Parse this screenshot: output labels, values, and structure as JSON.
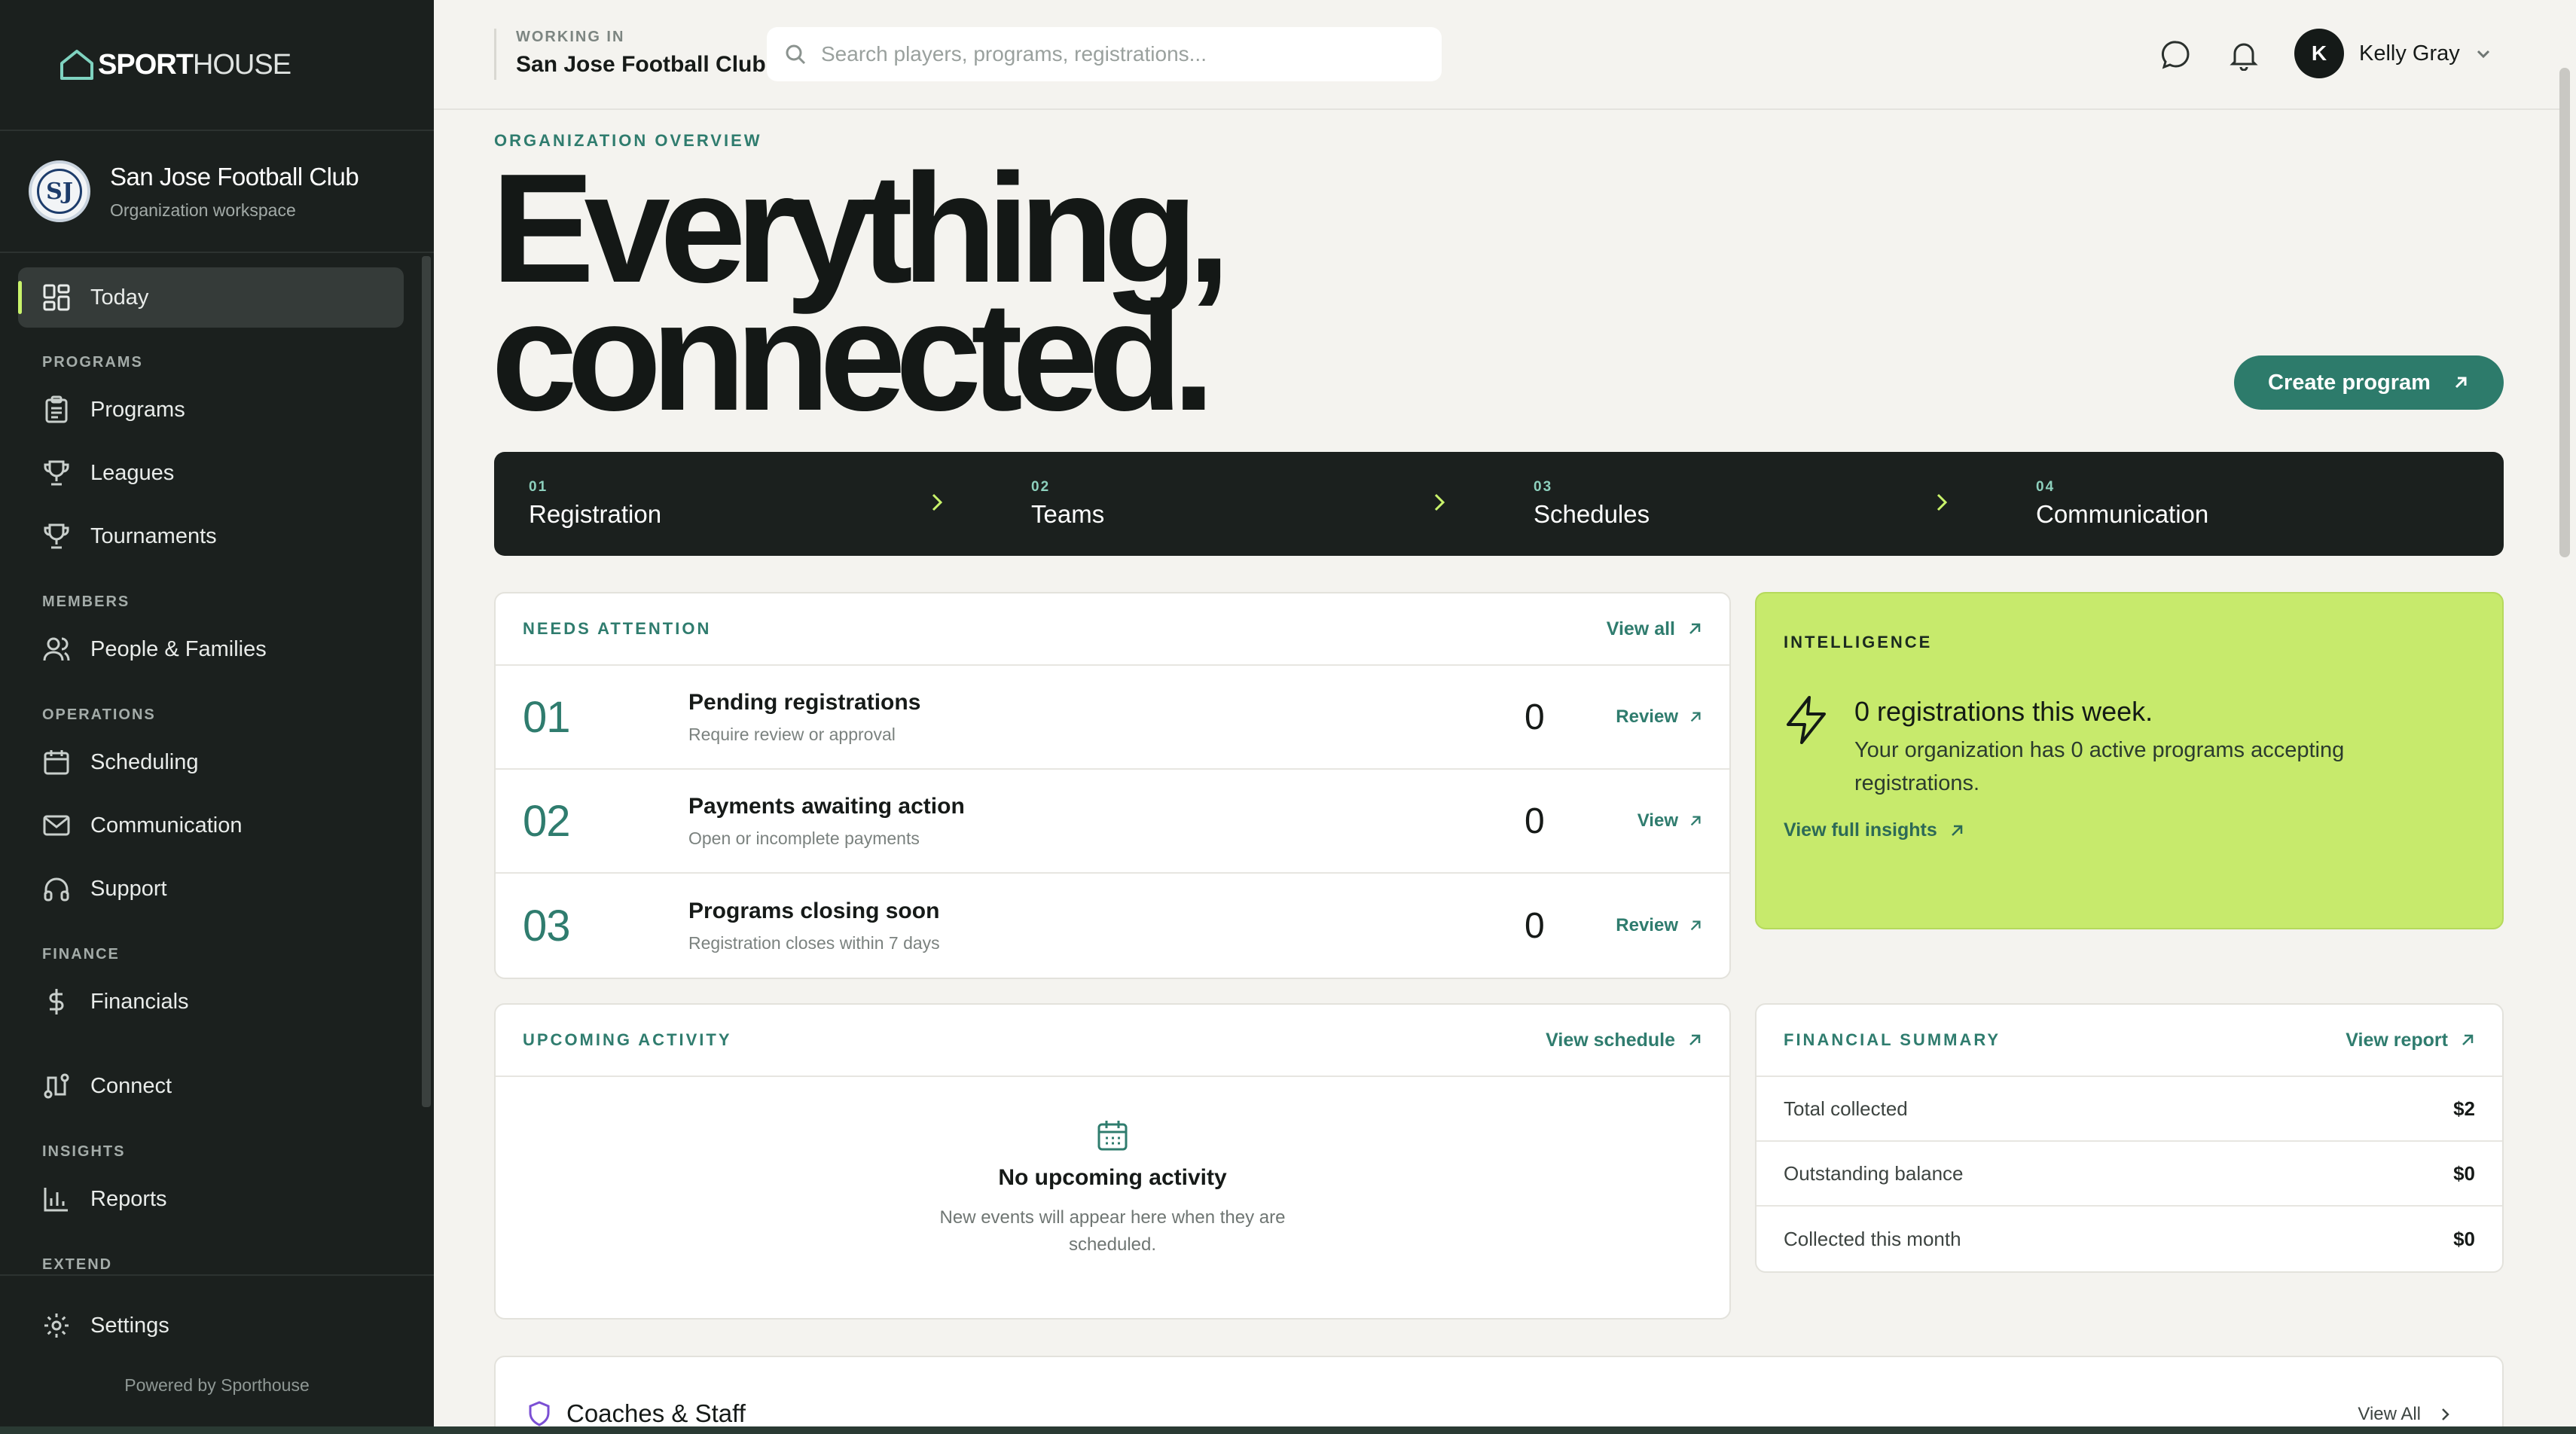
{
  "brand": {
    "bold": "SPORT",
    "light": "HOUSE"
  },
  "org": {
    "logo_text": "SJ",
    "name": "San Jose Football Club",
    "subtitle": "Organization workspace"
  },
  "nav": {
    "today": "Today",
    "sections": {
      "programs": "PROGRAMS",
      "members": "MEMBERS",
      "operations": "OPERATIONS",
      "finance": "FINANCE",
      "insights": "INSIGHTS",
      "extend": "EXTEND"
    },
    "programs": "Programs",
    "leagues": "Leagues",
    "tournaments": "Tournaments",
    "people": "People & Families",
    "scheduling": "Scheduling",
    "communication": "Communication",
    "support": "Support",
    "financials": "Financials",
    "connect": "Connect",
    "reports": "Reports",
    "settings": "Settings",
    "powered": "Powered by Sporthouse"
  },
  "topbar": {
    "working_in_label": "WORKING IN",
    "working_in_value": "San Jose Football Club",
    "search_placeholder": "Search players, programs, registrations...",
    "user_initial": "K",
    "user_name": "Kelly Gray"
  },
  "hero": {
    "eyebrow": "ORGANIZATION OVERVIEW",
    "line1": "Everything,",
    "line2": "connected.",
    "create_button": "Create program"
  },
  "steps": [
    {
      "num": "01",
      "label": "Registration"
    },
    {
      "num": "02",
      "label": "Teams"
    },
    {
      "num": "03",
      "label": "Schedules"
    },
    {
      "num": "04",
      "label": "Communication"
    }
  ],
  "attention": {
    "title": "NEEDS ATTENTION",
    "link": "View all",
    "rows": [
      {
        "num": "01",
        "title": "Pending registrations",
        "sub": "Require review or approval",
        "count": "0",
        "action": "Review"
      },
      {
        "num": "02",
        "title": "Payments awaiting action",
        "sub": "Open or incomplete payments",
        "count": "0",
        "action": "View"
      },
      {
        "num": "03",
        "title": "Programs closing soon",
        "sub": "Registration closes within 7 days",
        "count": "0",
        "action": "Review"
      }
    ]
  },
  "intelligence": {
    "title": "INTELLIGENCE",
    "headline": "0 registrations this week.",
    "body": "Your organization has 0 active programs accepting registrations.",
    "link": "View full insights"
  },
  "upcoming": {
    "title": "UPCOMING ACTIVITY",
    "link": "View schedule",
    "empty_title": "No upcoming activity",
    "empty_sub": "New events will appear here when they are scheduled."
  },
  "financial": {
    "title": "FINANCIAL SUMMARY",
    "link": "View report",
    "rows": [
      {
        "label": "Total collected",
        "value": "$2"
      },
      {
        "label": "Outstanding balance",
        "value": "$0"
      },
      {
        "label": "Collected this month",
        "value": "$0"
      }
    ]
  },
  "coaches": {
    "title": "Coaches & Staff",
    "link": "View All"
  },
  "colors": {
    "accent": "#2d7b6b",
    "lime": "#c7ea6c",
    "sidebar": "#1b201e"
  }
}
